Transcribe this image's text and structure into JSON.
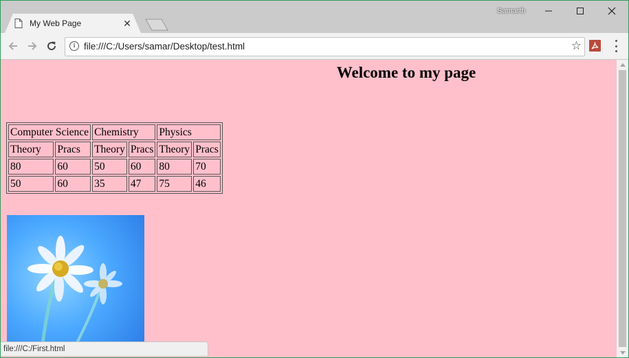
{
  "browser": {
    "tab_title": "My Web Page",
    "tab_close": "✕",
    "profile_name": "Samarth",
    "url": "file:///C:/Users/samar/Desktop/test.html",
    "info_glyph": "i",
    "star_glyph": "☆",
    "status_text": "file:///C:/First.html",
    "icons": [
      "page-icon",
      "back-arrow-icon",
      "forward-arrow-icon",
      "reload-icon",
      "info-icon",
      "star-icon",
      "pdf-extension-icon",
      "menu-dots-icon",
      "minimize-icon",
      "maximize-icon",
      "close-icon"
    ]
  },
  "page": {
    "heading": "Welcome to my page",
    "background": "#ffc0cb",
    "table": {
      "subjects": [
        "Computer Science",
        "Chemistry",
        "Physics"
      ],
      "subheaders": [
        "Theory",
        "Pracs",
        "Theory",
        "Pracs",
        "Theory",
        "Pracs"
      ],
      "rows": [
        [
          "80",
          "60",
          "50",
          "60",
          "80",
          "70"
        ],
        [
          "50",
          "60",
          "35",
          "47",
          "75",
          "46"
        ]
      ]
    },
    "image": {
      "subject": "white daisies on blue background"
    }
  }
}
